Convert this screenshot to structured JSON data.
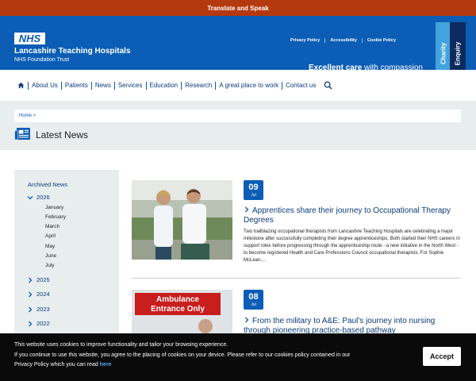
{
  "translate_bar": {
    "label": "Translate and Speak"
  },
  "header": {
    "logo_text": "NHS",
    "org_name": "Lancashire Teaching Hospitals",
    "org_sub": "NHS Foundation Trust",
    "utility_links": [
      "Privacy Policy",
      "Accessibility",
      "Cookie Policy"
    ],
    "tagline_bold": "Excellent care",
    "tagline_rest": " with compassion",
    "side_tabs": [
      "Charity",
      "Enquiry"
    ]
  },
  "nav": {
    "items": [
      "About Us",
      "Patients",
      "News",
      "Services",
      "Education",
      "Research",
      "A great place to work",
      "Contact us"
    ]
  },
  "breadcrumb": {
    "text": "Home >"
  },
  "page": {
    "title": "Latest News"
  },
  "sidebar": {
    "heading": "Archived News",
    "open_year": "2026",
    "months": [
      "January",
      "February",
      "March",
      "April",
      "May",
      "June",
      "July"
    ],
    "years": [
      "2025",
      "2024",
      "2023",
      "2022"
    ]
  },
  "articles": [
    {
      "day": "09",
      "month": "Jul",
      "title": "Apprentices share their journey to Occupational Therapy Degrees",
      "summary": "Two trailblazing occupational therapists from Lancashire Teaching Hospitals are celebrating a major milestone after successfully completing their degree apprenticeships. Both started their NHS careers in support roles before progressing through the apprenticeship route - a new initiative in the North West - to become registered Health and Care Professions Council occupational therapists. For Sophie McLean,..."
    },
    {
      "day": "08",
      "month": "Jul",
      "title": "From the military to A&E: Paul's journey into nursing through pioneering practice-based pathway",
      "summary": "",
      "image_sign": [
        "Ambulance",
        "Entrance Only"
      ]
    }
  ],
  "cookie": {
    "line1": "This website uses cookies to improve functionality and tailor your browsing experience.",
    "line2": "If you continue to use this website, you agree to the placing of cookies on your device. Please refer to our cookies policy contained in our",
    "line3": "Privacy Policy which you can read ",
    "link": "here",
    "accept": "Accept"
  },
  "colors": {
    "nhs_blue": "#0b5db5",
    "translate_bar": "#b5390f",
    "charity_tab": "#41a4de",
    "enquiry_tab": "#0b2b5e",
    "grey_panel": "#e8edee"
  }
}
